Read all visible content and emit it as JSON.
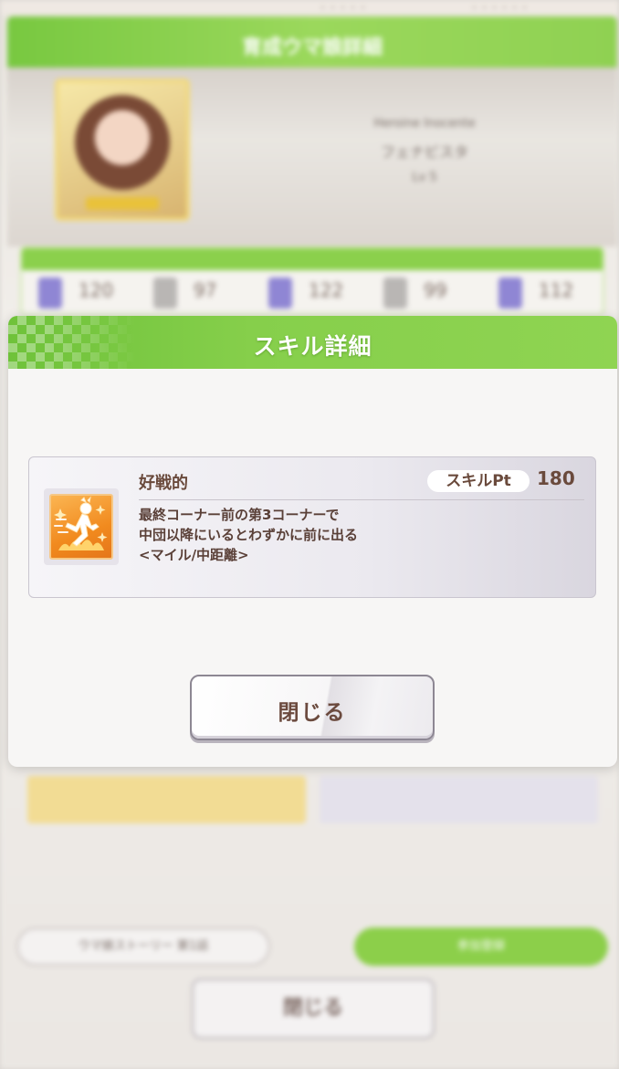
{
  "background": {
    "header_title": "育成ウマ娘詳細",
    "card_name": "Heroine Inocente",
    "character_name": "フェナビスタ",
    "level": "Lv 5",
    "stat_values": [
      "120",
      "97",
      "122",
      "99",
      "112"
    ],
    "bottom_left_button": "ウマ娘ストーリー 第1話",
    "bottom_right_button": "参加登録",
    "bottom_close_button": "閉じる"
  },
  "modal": {
    "title": "スキル詳細",
    "skill": {
      "name": "好戦的",
      "pt_label": "スキルPt",
      "pt_value": "180",
      "description": [
        "最終コーナー前の第3コーナーで",
        "中団以降にいるとわずかに前に出る",
        "<マイル/中距離>"
      ],
      "icon": "speed-runner-icon"
    },
    "close_label": "閉じる"
  },
  "colors": {
    "accent_green": "#7cc843",
    "text_brown": "#6a4a3c",
    "skill_icon_orange": "#f18a1e"
  }
}
